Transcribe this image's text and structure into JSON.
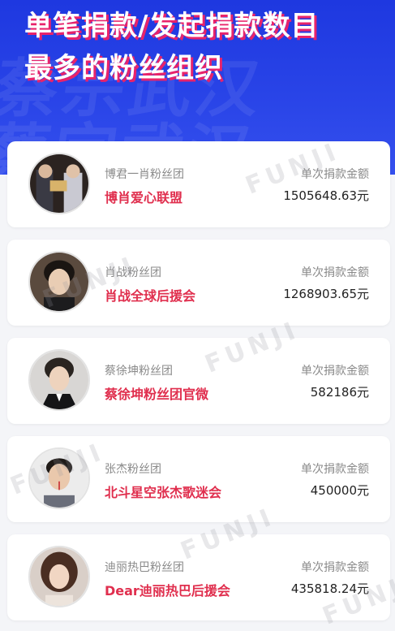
{
  "title": {
    "line1": "单笔捐款/发起捐款数目",
    "line2": "最多的粉丝组织"
  },
  "watermark_text": "FUNJI",
  "cards": [
    {
      "fan_group": "博君一肖粉丝团",
      "org_name": "博肖爱心联盟",
      "amount_label": "单次捐款金额",
      "amount": "1505648.63元"
    },
    {
      "fan_group": "肖战粉丝团",
      "org_name": "肖战全球后援会",
      "amount_label": "单次捐款金额",
      "amount": "1268903.65元"
    },
    {
      "fan_group": "蔡徐坤粉丝团",
      "org_name": "蔡徐坤粉丝团官微",
      "amount_label": "单次捐款金额",
      "amount": "582186元"
    },
    {
      "fan_group": "张杰粉丝团",
      "org_name": "北斗星空张杰歌迷会",
      "amount_label": "单次捐款金额",
      "amount": "450000元"
    },
    {
      "fan_group": "迪丽热巴粉丝团",
      "org_name": "Dear迪丽热巴后援会",
      "amount_label": "单次捐款金额",
      "amount": "435818.24元"
    }
  ],
  "colors": {
    "header_blue": "#2a45e8",
    "title_shadow_pink": "#e8236b",
    "org_name_red": "#e02f4e"
  }
}
